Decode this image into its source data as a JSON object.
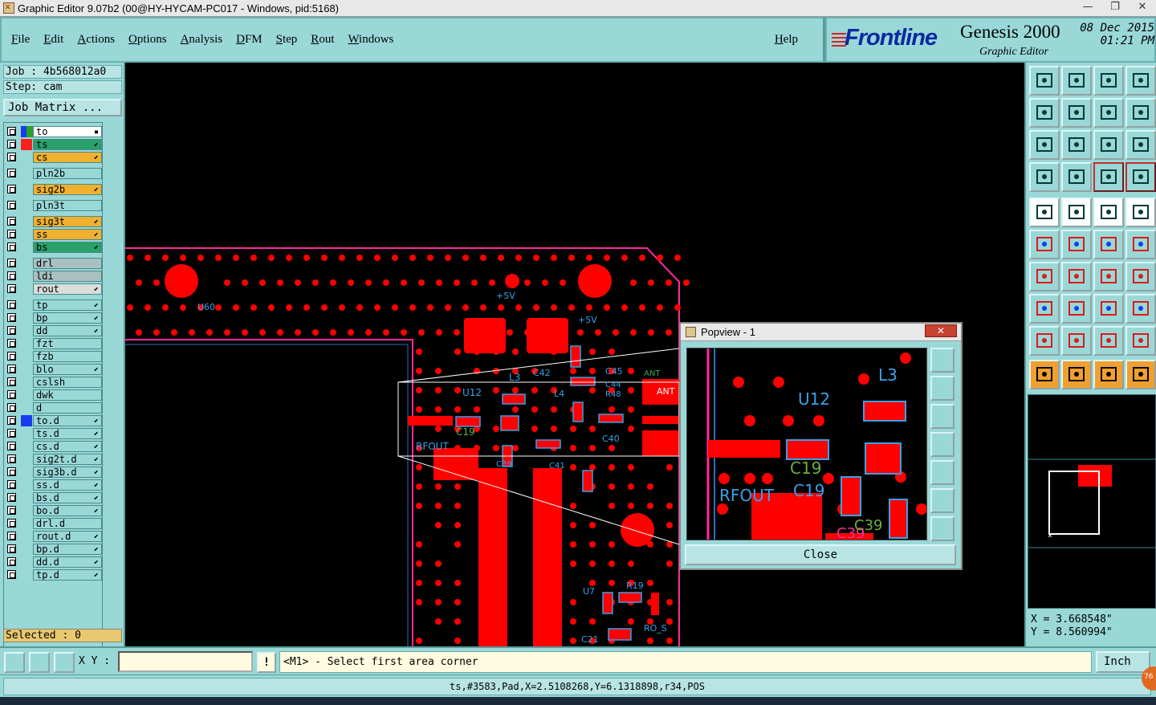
{
  "window": {
    "title": "Graphic Editor 9.07b2 (00@HY-HYCAM-PC017 - Windows, pid:5168)"
  },
  "menu": {
    "items": [
      "File",
      "Edit",
      "Actions",
      "Options",
      "Analysis",
      "DFM",
      "Step",
      "Rout",
      "Windows"
    ],
    "help": "Help"
  },
  "brand": {
    "logo": "Frontline",
    "product": "Genesis 2000",
    "subtitle": "Graphic Editor",
    "date": "08 Dec 2015",
    "time": "01:21 PM"
  },
  "job": {
    "job_text": "Job : 4b568012a0",
    "step_text": "Step: cam",
    "matrix_button": "Job Matrix ..."
  },
  "layers": [
    {
      "name": "to",
      "swatch": "#1a3af0",
      "swatch2": "#2aa02a",
      "bg": "#ffffff",
      "flag": "▪"
    },
    {
      "name": "ts",
      "swatch": "#ff2020",
      "bg": "#2aa06a",
      "flag": "⬋"
    },
    {
      "name": "cs",
      "bg": "#f0b030",
      "flag": "⬋"
    },
    {
      "name": "pln2b",
      "bg": "#9ad8d8",
      "gap": true
    },
    {
      "name": "sig2b",
      "bg": "#f0b030",
      "flag": "⬋",
      "gap": true
    },
    {
      "name": "pln3t",
      "bg": "#9ad8d8",
      "gap": true
    },
    {
      "name": "sig3t",
      "bg": "#f0b030",
      "flag": "⬋",
      "gap": true
    },
    {
      "name": "ss",
      "bg": "#f0b030",
      "flag": "⬋"
    },
    {
      "name": "bs",
      "bg": "#2aa06a",
      "flag": "⬋"
    },
    {
      "name": "drl",
      "bg": "#a8c0c0",
      "gap": true
    },
    {
      "name": "ldi",
      "bg": "#a8c0c0"
    },
    {
      "name": "rout",
      "bg": "#dcdcdc",
      "flag": "⬋"
    },
    {
      "name": "tp",
      "bg": "#9ad8d8",
      "flag": "⬋",
      "gap": true
    },
    {
      "name": "bp",
      "bg": "#9ad8d8",
      "flag": "⬋"
    },
    {
      "name": "dd",
      "bg": "#9ad8d8",
      "flag": "⬋"
    },
    {
      "name": "fzt",
      "bg": "#9ad8d8"
    },
    {
      "name": "fzb",
      "bg": "#9ad8d8"
    },
    {
      "name": "blo",
      "bg": "#9ad8d8",
      "flag": "⬋"
    },
    {
      "name": "cslsh",
      "bg": "#9ad8d8"
    },
    {
      "name": "dwk",
      "bg": "#9ad8d8"
    },
    {
      "name": "d",
      "bg": "#9ad8d8"
    },
    {
      "name": "to.d",
      "swatch": "#1a3af0",
      "bg": "#9ad8d8",
      "flag": "⬋"
    },
    {
      "name": "ts.d",
      "bg": "#9ad8d8",
      "flag": "⬋"
    },
    {
      "name": "cs.d",
      "bg": "#9ad8d8",
      "flag": "⬋"
    },
    {
      "name": "sig2t.d",
      "bg": "#9ad8d8",
      "flag": "⬋"
    },
    {
      "name": "sig3b.d",
      "bg": "#9ad8d8",
      "flag": "⬋"
    },
    {
      "name": "ss.d",
      "bg": "#9ad8d8",
      "flag": "⬋"
    },
    {
      "name": "bs.d",
      "bg": "#9ad8d8",
      "flag": "⬋"
    },
    {
      "name": "bo.d",
      "bg": "#9ad8d8",
      "flag": "⬋"
    },
    {
      "name": "drl.d",
      "bg": "#9ad8d8"
    },
    {
      "name": "rout.d",
      "bg": "#9ad8d8",
      "flag": "⬋"
    },
    {
      "name": "bp.d",
      "bg": "#9ad8d8",
      "flag": "⬋"
    },
    {
      "name": "dd.d",
      "bg": "#9ad8d8",
      "flag": "⬋"
    },
    {
      "name": "tp.d",
      "bg": "#9ad8d8",
      "flag": "⬋"
    }
  ],
  "selected": "Selected : 0",
  "canvas_labels": {
    "u60": "U60",
    "plus5v_a": "+5V",
    "plus5v_b": "+5V",
    "l3": "L3",
    "c42": "C42",
    "u12": "U12",
    "l4": "L4",
    "c45": "C45",
    "c44": "C44",
    "r48": "R48",
    "ant": "ANT",
    "ant2": "ANT",
    "c19": "C19",
    "rfout": "RFOUT",
    "c40": "C40",
    "c39": "C39",
    "c41": "C41",
    "u7": "U7",
    "r19": "R19",
    "c21": "C21",
    "ro_s": "RO_S"
  },
  "popview": {
    "title": "Popview - 1",
    "close": "Close",
    "labels": {
      "u12": "U12",
      "l3": "L3",
      "c19a": "C19",
      "rfout": "RFOUT",
      "c19b": "C19",
      "c39": "C39",
      "c39b": "C39"
    }
  },
  "coords": {
    "x": "X = 3.668548\"",
    "y": "Y = 8.560994\""
  },
  "command": {
    "xy_label": "X Y :",
    "prompt": "<M1> - Select first area corner",
    "unit": "Inch",
    "excl": "!"
  },
  "status": "ts,#3583,Pad,X=2.5108268,Y=6.1318898,r34,POS",
  "badge": "76",
  "colors": {
    "panel": "#9ad8d8",
    "pad": "#ff0000",
    "outline": "#ff2a9a",
    "silkscreen": "#3aa0e8",
    "component": "#6ab040"
  }
}
